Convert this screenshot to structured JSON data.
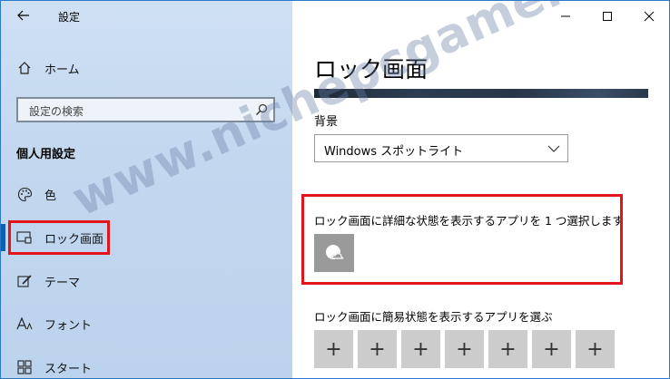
{
  "window": {
    "app_title": "設定",
    "controls": {
      "minimize": "minimize-icon",
      "maximize": "maximize-icon",
      "close": "close-icon"
    }
  },
  "sidebar": {
    "home_label": "ホーム",
    "search": {
      "placeholder": "設定の検索",
      "value": ""
    },
    "section_heading": "個人用設定",
    "items": [
      {
        "label": "色",
        "icon": "palette-icon",
        "selected": false
      },
      {
        "label": "ロック画面",
        "icon": "lock-screen-icon",
        "selected": true
      },
      {
        "label": "テーマ",
        "icon": "theme-brush-icon",
        "selected": false
      },
      {
        "label": "フォント",
        "icon": "font-icon",
        "selected": false
      },
      {
        "label": "スタート",
        "icon": "start-icon",
        "selected": false
      }
    ]
  },
  "main": {
    "title": "ロック画面",
    "background_label": "背景",
    "background_value": "Windows スポットライト",
    "detailed_status_label": "ロック画面に詳細な状態を表示するアプリを 1 つ選択します",
    "detailed_status_app": "weather-app-icon",
    "quick_status_label": "ロック画面に簡易状態を表示するアプリを選ぶ",
    "quick_status_slots": [
      "+",
      "+",
      "+",
      "+",
      "+",
      "+",
      "+"
    ]
  },
  "overlay": {
    "watermark": "www.nichepcgamer.com"
  },
  "colors": {
    "highlight_red": "#e4141b",
    "accent_blue": "#0b61b3",
    "sidebar_bg": "#c3d8ef",
    "tile_gray": "#cccccc"
  }
}
